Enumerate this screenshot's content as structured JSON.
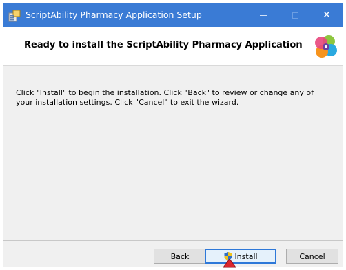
{
  "window": {
    "title": "ScriptAbility Pharmacy Application Setup",
    "controls": {
      "minimize": "minimize",
      "maximize": "maximize",
      "close": "close"
    }
  },
  "banner": {
    "heading": "Ready to install the ScriptAbility Pharmacy Application"
  },
  "content": {
    "description": "Click \"Install\" to begin the installation. Click \"Back\" to review or change any of your installation settings. Click \"Cancel\" to exit the wizard."
  },
  "buttons": {
    "back": "Back",
    "install": "Install",
    "cancel": "Cancel"
  },
  "icons": {
    "app": "installer-icon",
    "logo": "scriptability-logo",
    "shield": "uac-shield-icon",
    "pointer": "arrow-cursor-icon"
  },
  "colors": {
    "titlebar": "#3a7bd5",
    "default_button_border": "#2e78d8",
    "pointer": "#d9262e"
  }
}
